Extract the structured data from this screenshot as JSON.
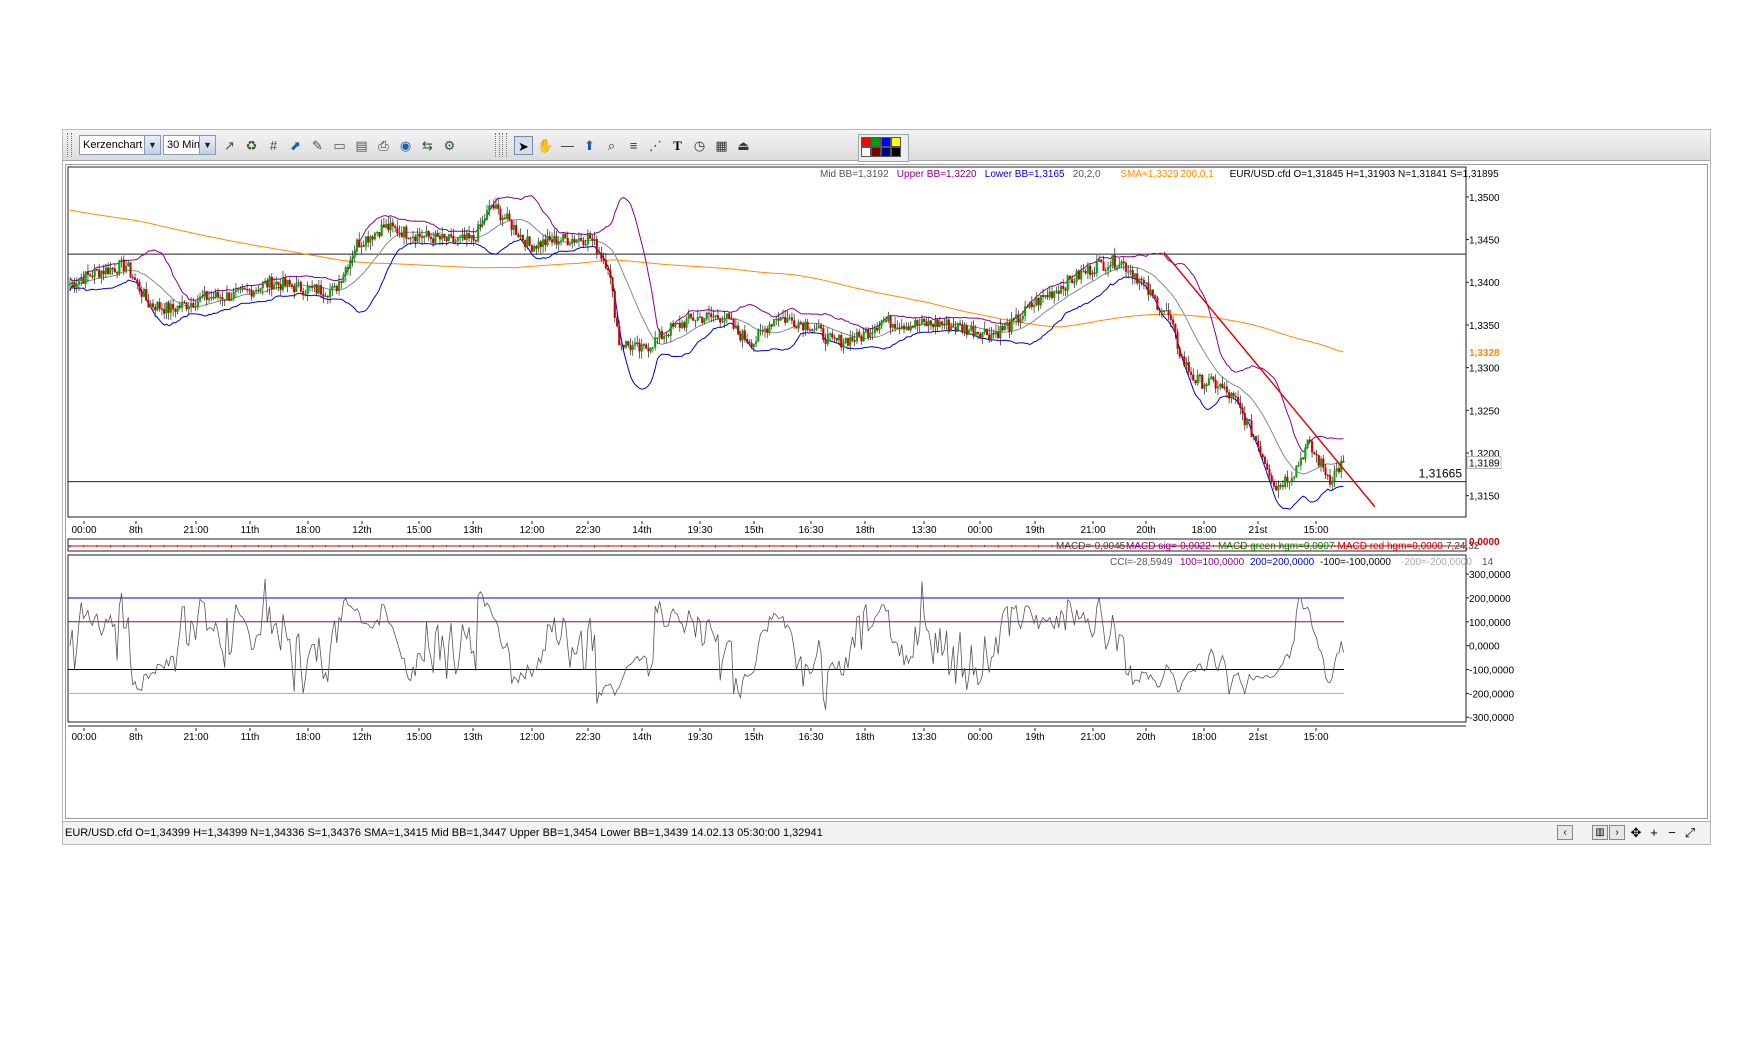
{
  "toolbar": {
    "chart_type": "Kerzenchart",
    "interval": "30 Min.",
    "icons": [
      "chart-line-icon",
      "refresh-green-icon",
      "grid-icon",
      "trend-icon",
      "edit-icon",
      "window-icon",
      "document-icon",
      "print-icon",
      "globe-icon",
      "compare-icon",
      "settings-icon"
    ],
    "draw_icons": [
      "cursor-icon",
      "hand-icon",
      "horizontal-line-icon",
      "arrow-up-icon",
      "zoom-icon",
      "fibonacci-icon",
      "fan-icon",
      "text-icon",
      "clock-icon",
      "calculator-icon",
      "exit-icon"
    ],
    "palette": [
      "#ff0000",
      "#00a000",
      "#0000ff",
      "#ffff00",
      "#ffffff",
      "#800000",
      "#000080",
      "#000000"
    ]
  },
  "main_panel": {
    "bb_legend": {
      "mid": "Mid BB=1,3192",
      "upper": "Upper BB=1,3220",
      "lower": "Lower BB=1,3165",
      "params": "20,2,0"
    },
    "sma_legend": {
      "value": "SMA=1,3329",
      "params": "200,0,1"
    },
    "ohlc_legend": "EUR/USD.cfd O=1,31845 H=1,31903 N=1,31841 S=1,31895",
    "y_ticks": [
      "1,3500",
      "1,3450",
      "1,3400",
      "1,3350",
      "1,3300",
      "1,3250",
      "1,3200",
      "1,3150"
    ],
    "sma_tag": "1,3328",
    "last_tag": "1,3189",
    "level_label": "1,31665",
    "colors": {
      "upper_bb": "#8b008b",
      "lower_bb": "#0000cd",
      "mid_bb": "#888888",
      "sma": "#ff8c00",
      "trend": "#e00000",
      "bull": "#00aa00",
      "bear": "#cc0000"
    }
  },
  "x_labels": [
    "00:00",
    "8th",
    "21:00",
    "11th",
    "18:00",
    "12th",
    "15:00",
    "13th",
    "12:00",
    "22:30",
    "14th",
    "19:30",
    "15th",
    "16:30",
    "18th",
    "13:30",
    "00:00",
    "19th",
    "21:00",
    "20th",
    "18:00",
    "21st",
    "15:00"
  ],
  "macd_panel": {
    "legend": {
      "macd": "MACD=-0,0045",
      "signal": "MACD sig=-0,0022",
      "green": "MACD green hgm=0,0007",
      "red": "MACD red hgm=0,0000",
      "params": "7,24,32"
    },
    "tag": "0,0000"
  },
  "cci_panel": {
    "legend": {
      "cci": "CCI=-28,5949",
      "l100": "100=100,0000",
      "l200": "200=200,0000",
      "m100": "-100=-100,0000",
      "m200": "-200=-200,0000",
      "period": "14"
    },
    "y_ticks": [
      "300,0000",
      "200,0000",
      "100,0000",
      "0,0000",
      "-100,0000",
      "-200,0000",
      "-300,0000"
    ]
  },
  "chart_data": {
    "type": "candlestick",
    "symbol": "EUR/USD.cfd",
    "interval": "30 Min.",
    "ylim": [
      1.3125,
      1.3535
    ],
    "levels": [
      1.3433,
      1.31665
    ],
    "anchors": [
      [
        0,
        1.3398
      ],
      [
        12,
        1.3412
      ],
      [
        25,
        1.342
      ],
      [
        35,
        1.3375
      ],
      [
        45,
        1.3368
      ],
      [
        60,
        1.3382
      ],
      [
        75,
        1.3385
      ],
      [
        90,
        1.34
      ],
      [
        105,
        1.3392
      ],
      [
        118,
        1.339
      ],
      [
        128,
        1.3445
      ],
      [
        140,
        1.3465
      ],
      [
        155,
        1.3455
      ],
      [
        170,
        1.3448
      ],
      [
        180,
        1.345
      ],
      [
        188,
        1.349
      ],
      [
        196,
        1.347
      ],
      [
        205,
        1.3443
      ],
      [
        218,
        1.345
      ],
      [
        232,
        1.3452
      ],
      [
        240,
        1.342
      ],
      [
        245,
        1.333
      ],
      [
        255,
        1.332
      ],
      [
        268,
        1.3345
      ],
      [
        278,
        1.3358
      ],
      [
        292,
        1.336
      ],
      [
        298,
        1.334
      ],
      [
        305,
        1.333
      ],
      [
        315,
        1.336
      ],
      [
        330,
        1.335
      ],
      [
        340,
        1.333
      ],
      [
        352,
        1.3335
      ],
      [
        362,
        1.3355
      ],
      [
        375,
        1.335
      ],
      [
        388,
        1.3352
      ],
      [
        400,
        1.3345
      ],
      [
        412,
        1.334
      ],
      [
        420,
        1.335
      ],
      [
        430,
        1.3375
      ],
      [
        445,
        1.34
      ],
      [
        458,
        1.342
      ],
      [
        468,
        1.3425
      ],
      [
        475,
        1.341
      ],
      [
        482,
        1.3385
      ],
      [
        490,
        1.336
      ],
      [
        496,
        1.331
      ],
      [
        502,
        1.3285
      ],
      [
        512,
        1.328
      ],
      [
        520,
        1.326
      ],
      [
        530,
        1.321
      ],
      [
        538,
        1.316
      ],
      [
        546,
        1.3178
      ],
      [
        552,
        1.321
      ],
      [
        556,
        1.3195
      ],
      [
        562,
        1.317
      ],
      [
        568,
        1.3189
      ]
    ],
    "bb_period": 20,
    "bb_dev": 2,
    "sma_period": 200,
    "cci_period": 14,
    "cci_ylim": [
      -320,
      380
    ],
    "cci_levels": [
      200,
      100,
      -100,
      -200
    ]
  }
}
